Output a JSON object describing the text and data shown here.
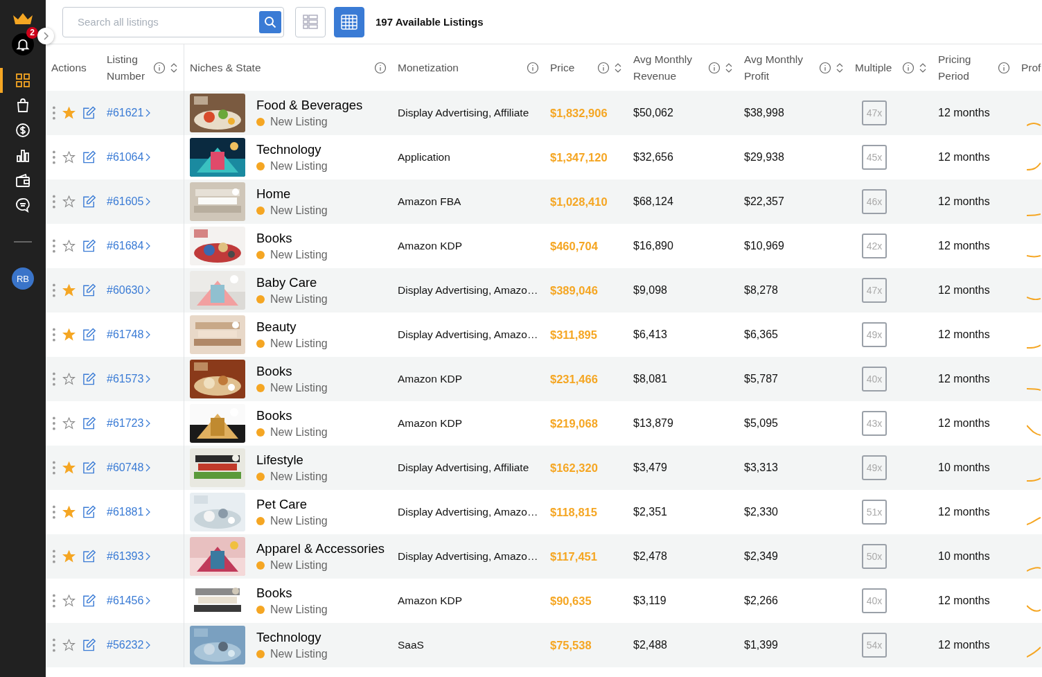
{
  "sidebar": {
    "notifications": {
      "badge": "2"
    },
    "items": [
      {
        "kind": "grid",
        "selected": true
      },
      {
        "kind": "bag",
        "selected": false
      },
      {
        "kind": "dollar",
        "selected": false
      },
      {
        "kind": "chart",
        "selected": false
      },
      {
        "kind": "wallet",
        "selected": false
      },
      {
        "kind": "chat",
        "selected": false
      }
    ],
    "avatar": "RB"
  },
  "toolbar": {
    "search": {
      "placeholder": "Search all listings"
    },
    "view_toggles": [
      {
        "kind": "list",
        "selected": false
      },
      {
        "kind": "table",
        "selected": true
      }
    ],
    "count": "197 Available Listings"
  },
  "table": {
    "columns": [
      {
        "label": "Actions",
        "info": false,
        "sortable": false
      },
      {
        "label": "Listing Number",
        "info": true,
        "sortable": true
      },
      {
        "label": "Niches & State",
        "info": true,
        "sortable": false
      },
      {
        "label": "Monetization",
        "info": true,
        "sortable": false
      },
      {
        "label": "Price",
        "info": true,
        "sortable": true
      },
      {
        "label": "Avg Monthly Revenue",
        "info": true,
        "sortable": true
      },
      {
        "label": "Avg Monthly Profit",
        "info": true,
        "sortable": true
      },
      {
        "label": "Multiple",
        "info": true,
        "sortable": true
      },
      {
        "label": "Pricing Period",
        "info": true,
        "sortable": false
      },
      {
        "label": "Prof",
        "info": false,
        "sortable": false
      }
    ],
    "rows": [
      {
        "starred": true,
        "number": "#61621",
        "niche": "Food & Beverages",
        "state": "New Listing",
        "monetization": "Display Advertising, Affiliate",
        "price": "$1,832,906",
        "revenue": "$50,062",
        "profit": "$38,998",
        "multiple": "47x",
        "period": "12 months"
      },
      {
        "starred": false,
        "number": "#61064",
        "niche": "Technology",
        "state": "New Listing",
        "monetization": "Application",
        "price": "$1,347,120",
        "revenue": "$32,656",
        "profit": "$29,938",
        "multiple": "45x",
        "period": "12 months"
      },
      {
        "starred": false,
        "number": "#61605",
        "niche": "Home",
        "state": "New Listing",
        "monetization": "Amazon FBA",
        "price": "$1,028,410",
        "revenue": "$68,124",
        "profit": "$22,357",
        "multiple": "46x",
        "period": "12 months"
      },
      {
        "starred": false,
        "number": "#61684",
        "niche": "Books",
        "state": "New Listing",
        "monetization": "Amazon KDP",
        "price": "$460,704",
        "revenue": "$16,890",
        "profit": "$10,969",
        "multiple": "42x",
        "period": "12 months"
      },
      {
        "starred": true,
        "number": "#60630",
        "niche": "Baby Care",
        "state": "New Listing",
        "monetization": "Display Advertising, Amazo…",
        "price": "$389,046",
        "revenue": "$9,098",
        "profit": "$8,278",
        "multiple": "47x",
        "period": "12 months"
      },
      {
        "starred": true,
        "number": "#61748",
        "niche": "Beauty",
        "state": "New Listing",
        "monetization": "Display Advertising, Amazo…",
        "price": "$311,895",
        "revenue": "$6,413",
        "profit": "$6,365",
        "multiple": "49x",
        "period": "12 months"
      },
      {
        "starred": false,
        "number": "#61573",
        "niche": "Books",
        "state": "New Listing",
        "monetization": "Amazon KDP",
        "price": "$231,466",
        "revenue": "$8,081",
        "profit": "$5,787",
        "multiple": "40x",
        "period": "12 months"
      },
      {
        "starred": false,
        "number": "#61723",
        "niche": "Books",
        "state": "New Listing",
        "monetization": "Amazon KDP",
        "price": "$219,068",
        "revenue": "$13,879",
        "profit": "$5,095",
        "multiple": "43x",
        "period": "12 months"
      },
      {
        "starred": true,
        "number": "#60748",
        "niche": "Lifestyle",
        "state": "New Listing",
        "monetization": "Display Advertising, Affiliate",
        "price": "$162,320",
        "revenue": "$3,479",
        "profit": "$3,313",
        "multiple": "49x",
        "period": "10 months"
      },
      {
        "starred": true,
        "number": "#61881",
        "niche": "Pet Care",
        "state": "New Listing",
        "monetization": "Display Advertising, Amazo…",
        "price": "$118,815",
        "revenue": "$2,351",
        "profit": "$2,330",
        "multiple": "51x",
        "period": "12 months"
      },
      {
        "starred": true,
        "number": "#61393",
        "niche": "Apparel & Accessories",
        "state": "New Listing",
        "monetization": "Display Advertising, Amazo…",
        "price": "$117,451",
        "revenue": "$2,478",
        "profit": "$2,349",
        "multiple": "50x",
        "period": "10 months"
      },
      {
        "starred": false,
        "number": "#61456",
        "niche": "Books",
        "state": "New Listing",
        "monetization": "Amazon KDP",
        "price": "$90,635",
        "revenue": "$3,119",
        "profit": "$2,266",
        "multiple": "40x",
        "period": "12 months"
      },
      {
        "starred": false,
        "number": "#56232",
        "niche": "Technology",
        "state": "New Listing",
        "monetization": "SaaS",
        "price": "$75,538",
        "revenue": "$2,488",
        "profit": "$1,399",
        "multiple": "54x",
        "period": "12 months"
      }
    ]
  }
}
